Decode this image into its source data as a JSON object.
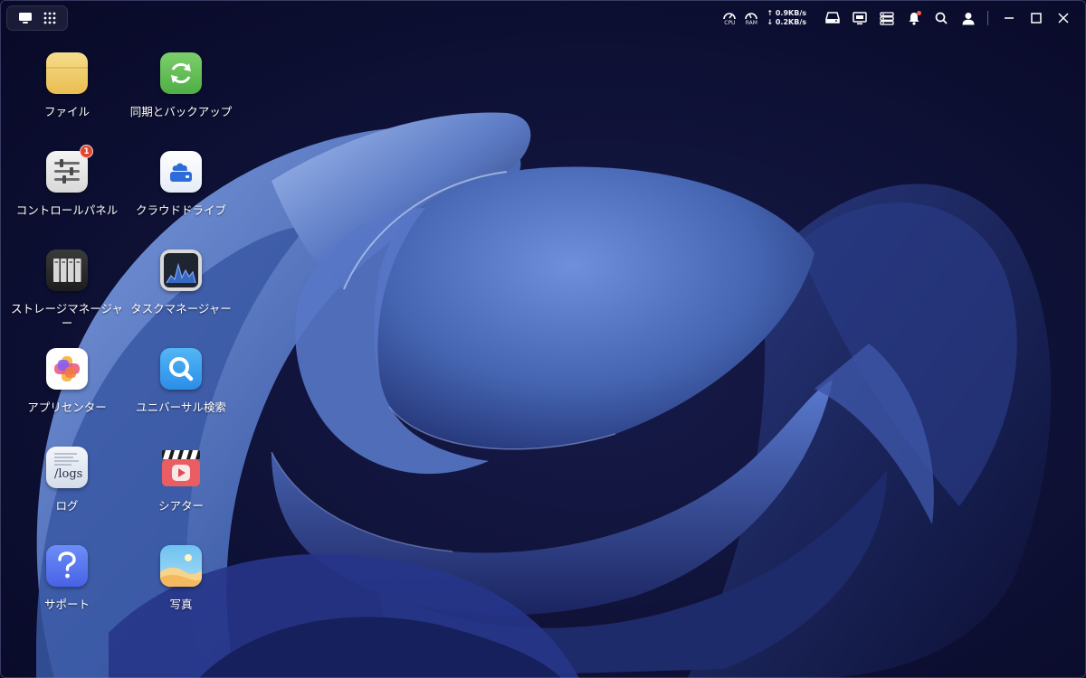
{
  "topbar": {
    "cpu_label": "CPU",
    "ram_label": "RAM",
    "upload_speed": "↑ 0.9KB/s",
    "download_speed": "↓ 0.2KB/s"
  },
  "desktop": {
    "icons": [
      {
        "label": "ファイル",
        "icon": "folder-icon"
      },
      {
        "label": "同期とバックアップ",
        "icon": "sync-icon"
      },
      {
        "label": "コントロールパネル",
        "icon": "control-panel-icon",
        "badge": "1"
      },
      {
        "label": "クラウドドライブ",
        "icon": "cloud-drive-icon"
      },
      {
        "label": "ストレージマネージャー",
        "icon": "storage-manager-icon"
      },
      {
        "label": "タスクマネージャー",
        "icon": "task-manager-icon"
      },
      {
        "label": "アプリセンター",
        "icon": "app-center-icon"
      },
      {
        "label": "ユニバーサル検索",
        "icon": "universal-search-icon"
      },
      {
        "label": "ログ",
        "icon": "logs-icon",
        "tile_text": "/logs"
      },
      {
        "label": "シアター",
        "icon": "theater-icon"
      },
      {
        "label": "サポート",
        "icon": "support-icon"
      },
      {
        "label": "写真",
        "icon": "photos-icon"
      }
    ]
  },
  "colors": {
    "background": "#0b0c2a",
    "wallpaper_blue": "#4a6bb5",
    "badge_red": "#e5452e",
    "notification_dot": "#ff5a4e"
  }
}
